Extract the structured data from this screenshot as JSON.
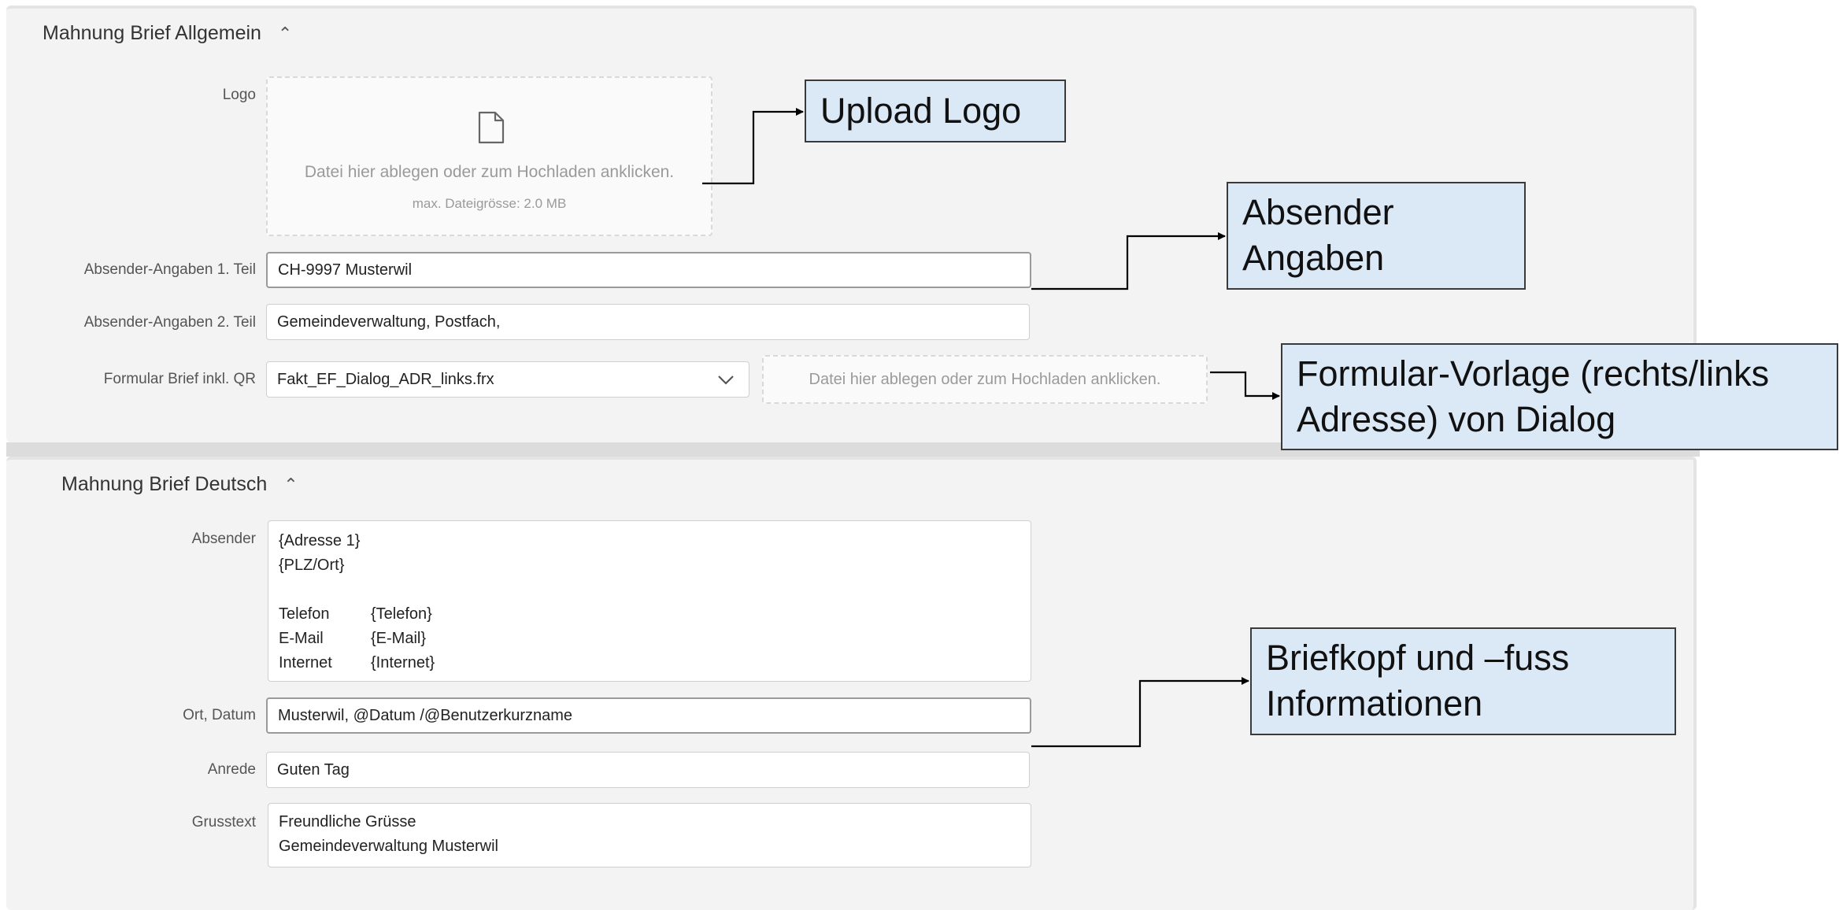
{
  "allgemein": {
    "title": "Mahnung Brief Allgemein",
    "logo_label": "Logo",
    "logo_drop_text": "Datei hier ablegen oder zum Hochladen anklicken.",
    "logo_drop_hint": "max. Dateigrösse: 2.0 MB",
    "absender1_label": "Absender-Angaben 1. Teil",
    "absender1_value": "CH-9997 Musterwil",
    "absender2_label": "Absender-Angaben 2. Teil",
    "absender2_value": "Gemeindeverwaltung, Postfach,",
    "formular_label": "Formular Brief inkl. QR",
    "formular_value": "Fakt_EF_Dialog_ADR_links.frx",
    "formular_drop_text": "Datei hier ablegen oder zum Hochladen anklicken."
  },
  "deutsch": {
    "title": "Mahnung Brief Deutsch",
    "absender_label": "Absender",
    "absender_lines": [
      "{Adresse 1}",
      "{PLZ/Ort}"
    ],
    "absender_rows": [
      {
        "k": "Telefon",
        "v": "{Telefon}"
      },
      {
        "k": "E-Mail",
        "v": "{E-Mail}"
      },
      {
        "k": "Internet",
        "v": "{Internet}"
      }
    ],
    "ort_label": "Ort, Datum",
    "ort_value": "Musterwil, @Datum /@Benutzerkurzname",
    "anrede_label": "Anrede",
    "anrede_value": "Guten Tag",
    "gruss_label": "Grusstext",
    "gruss_lines": [
      "Freundliche Grüsse",
      "Gemeindeverwaltung Musterwil"
    ]
  },
  "callouts": {
    "upload_logo": "Upload Logo",
    "absender_line1": "Absender",
    "absender_line2": "Angaben",
    "formular_line1": "Formular-Vorlage (rechts/links",
    "formular_line2": "Adresse) von Dialog",
    "brief_line1": "Briefkopf und –fuss",
    "brief_line2": "Informationen"
  },
  "icons": {
    "collapse": "chevron-up-icon",
    "file": "file-icon",
    "dropdown": "chevron-down-icon"
  },
  "colors": {
    "callout_fill": "#dbe8f6",
    "panel_bg": "#f3f3f3"
  }
}
